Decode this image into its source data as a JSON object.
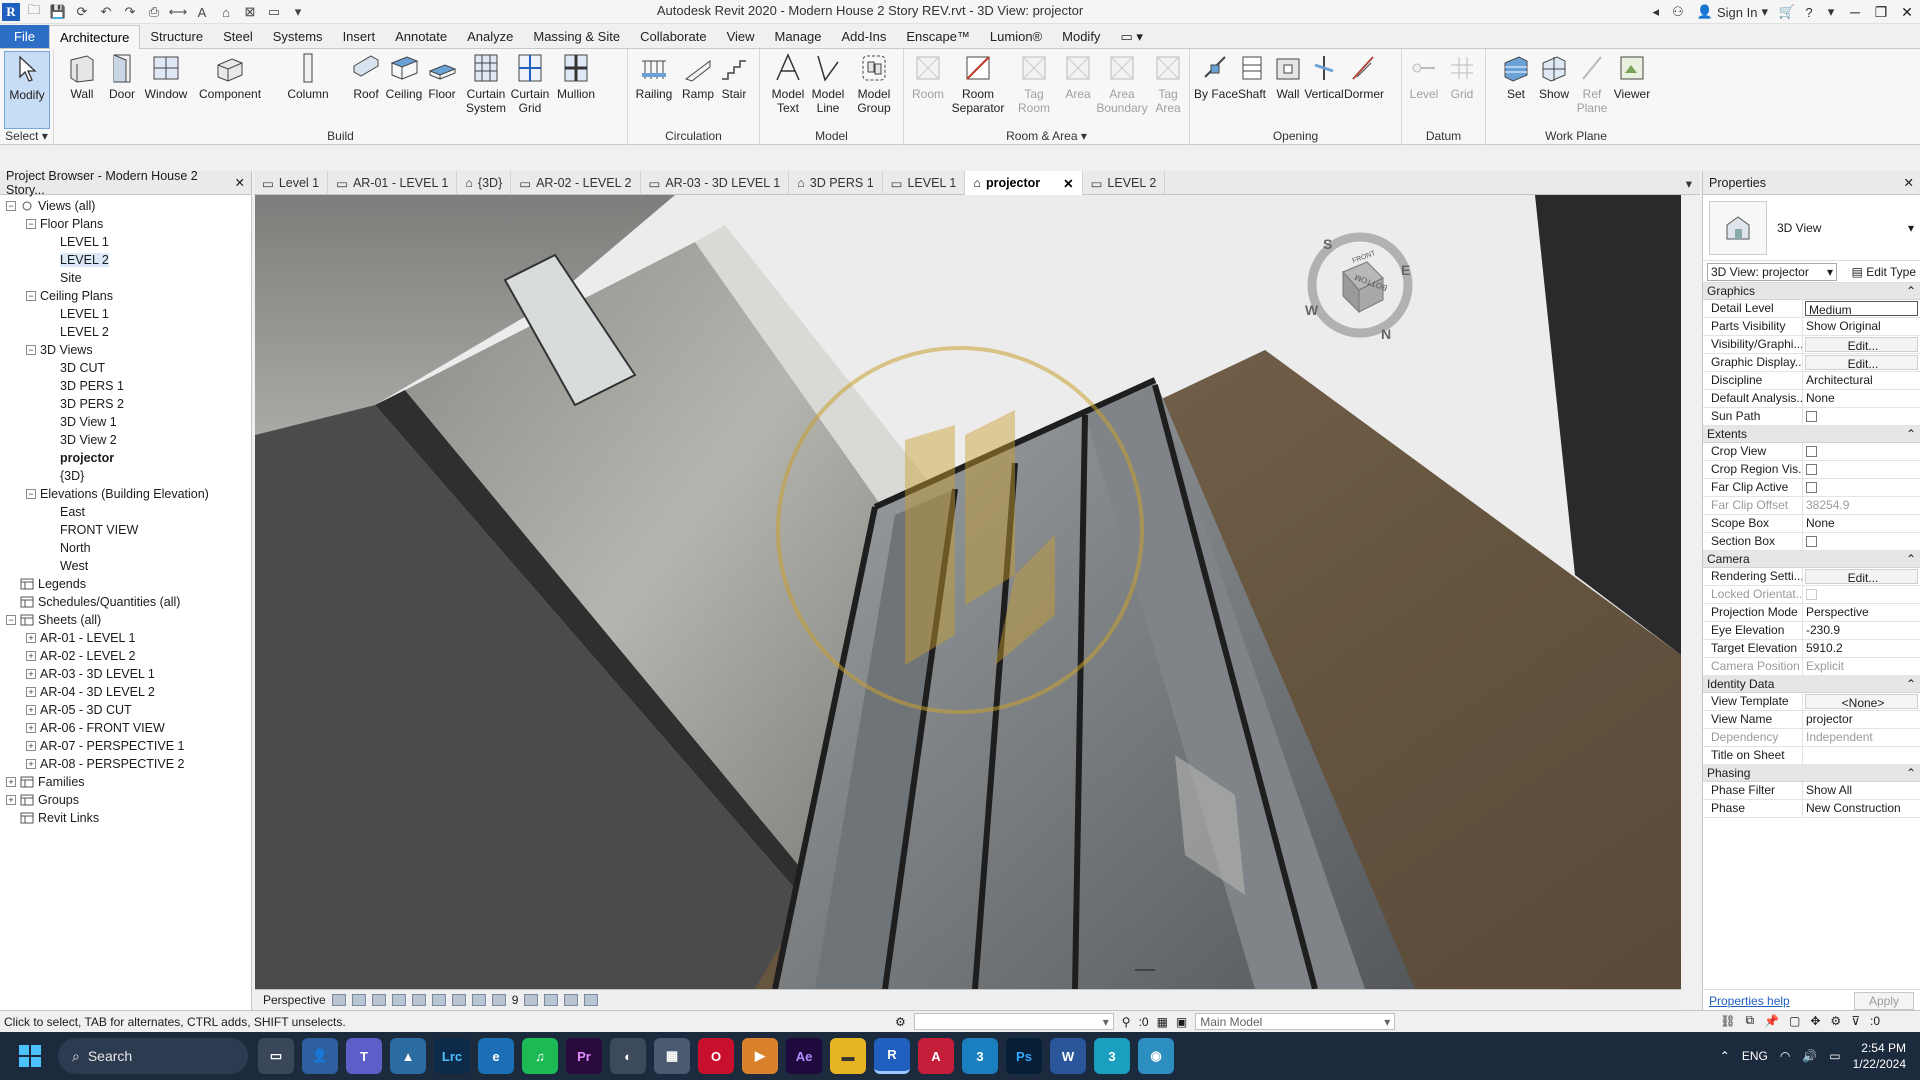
{
  "window": {
    "title": "Autodesk Revit 2020 - Modern House 2 Story REV.rvt - 3D View: projector",
    "sign_in": "Sign In"
  },
  "ribbon_tabs": [
    "File",
    "Architecture",
    "Structure",
    "Steel",
    "Systems",
    "Insert",
    "Annotate",
    "Analyze",
    "Massing & Site",
    "Collaborate",
    "View",
    "Manage",
    "Add-Ins",
    "Enscape™",
    "Lumion®",
    "Modify"
  ],
  "ribbon": {
    "select_label": "Select ▾",
    "groups": {
      "build": "Build",
      "circulation": "Circulation",
      "model": "Model",
      "room_area": "Room & Area ▾",
      "opening": "Opening",
      "datum": "Datum",
      "work_plane": "Work Plane"
    },
    "buttons": {
      "modify": "Modify",
      "wall": "Wall",
      "door": "Door",
      "window": "Window",
      "component": "Component",
      "column": "Column",
      "roof": "Roof",
      "ceiling": "Ceiling",
      "floor": "Floor",
      "curtain_system": "Curtain System",
      "curtain_grid": "Curtain Grid",
      "mullion": "Mullion",
      "railing": "Railing",
      "ramp": "Ramp",
      "stair": "Stair",
      "model_text": "Model Text",
      "model_line": "Model Line",
      "model_group": "Model Group",
      "room": "Room",
      "room_separator": "Room Separator",
      "tag_room": "Tag Room",
      "area": "Area",
      "area_boundary": "Area Boundary",
      "tag_area": "Tag Area",
      "by_face": "By Face",
      "shaft": "Shaft",
      "wall_opening": "Wall",
      "vertical": "Vertical",
      "dormer": "Dormer",
      "level": "Level",
      "grid": "Grid",
      "set": "Set",
      "show": "Show",
      "ref_plane": "Ref Plane",
      "viewer": "Viewer"
    }
  },
  "view_tabs": [
    {
      "label": "Level 1"
    },
    {
      "label": "AR-01 - LEVEL 1"
    },
    {
      "label": "{3D}"
    },
    {
      "label": "AR-02 - LEVEL 2"
    },
    {
      "label": "AR-03 - 3D LEVEL 1"
    },
    {
      "label": "3D PERS 1"
    },
    {
      "label": "LEVEL 1"
    },
    {
      "label": "projector"
    },
    {
      "label": "LEVEL 2"
    }
  ],
  "project_browser": {
    "title": "Project Browser - Modern House 2 Story...",
    "tree": [
      {
        "label": "Views (all)",
        "level": 0,
        "exp": "−"
      },
      {
        "label": "Floor Plans",
        "level": 1,
        "exp": "−"
      },
      {
        "label": "LEVEL 1",
        "level": 2
      },
      {
        "label": "LEVEL 2",
        "level": 2,
        "sel": true
      },
      {
        "label": "Site",
        "level": 2
      },
      {
        "label": "Ceiling Plans",
        "level": 1,
        "exp": "−"
      },
      {
        "label": "LEVEL 1",
        "level": 2
      },
      {
        "label": "LEVEL 2",
        "level": 2
      },
      {
        "label": "3D Views",
        "level": 1,
        "exp": "−"
      },
      {
        "label": "3D CUT",
        "level": 2
      },
      {
        "label": "3D PERS 1",
        "level": 2
      },
      {
        "label": "3D PERS 2",
        "level": 2
      },
      {
        "label": "3D View 1",
        "level": 2
      },
      {
        "label": "3D View 2",
        "level": 2
      },
      {
        "label": "projector",
        "level": 2,
        "bold": true
      },
      {
        "label": "{3D}",
        "level": 2
      },
      {
        "label": "Elevations (Building Elevation)",
        "level": 1,
        "exp": "−"
      },
      {
        "label": "East",
        "level": 2
      },
      {
        "label": "FRONT VIEW",
        "level": 2
      },
      {
        "label": "North",
        "level": 2
      },
      {
        "label": "West",
        "level": 2
      },
      {
        "label": "Legends",
        "level": 0,
        "icon": true
      },
      {
        "label": "Schedules/Quantities (all)",
        "level": 0,
        "icon": true
      },
      {
        "label": "Sheets (all)",
        "level": 0,
        "exp": "−",
        "icon": true
      },
      {
        "label": "AR-01 - LEVEL 1",
        "level": 1,
        "exp": "+"
      },
      {
        "label": "AR-02 - LEVEL 2",
        "level": 1,
        "exp": "+"
      },
      {
        "label": "AR-03 - 3D LEVEL 1",
        "level": 1,
        "exp": "+"
      },
      {
        "label": "AR-04 - 3D LEVEL 2",
        "level": 1,
        "exp": "+"
      },
      {
        "label": "AR-05 - 3D CUT",
        "level": 1,
        "exp": "+"
      },
      {
        "label": "AR-06 - FRONT VIEW",
        "level": 1,
        "exp": "+"
      },
      {
        "label": "AR-07 - PERSPECTIVE 1",
        "level": 1,
        "exp": "+"
      },
      {
        "label": "AR-08 - PERSPECTIVE 2",
        "level": 1,
        "exp": "+"
      },
      {
        "label": "Families",
        "level": 0,
        "exp": "+",
        "icon": true
      },
      {
        "label": "Groups",
        "level": 0,
        "exp": "+",
        "icon": true
      },
      {
        "label": "Revit Links",
        "level": 0,
        "icon": true
      }
    ]
  },
  "view_bar": {
    "mode": "Perspective",
    "scale": "9"
  },
  "viewcube": {
    "front": "FRONT",
    "bottom": "BOTTOM",
    "compass": {
      "n": "N",
      "s": "S",
      "e": "E",
      "w": "W"
    }
  },
  "properties": {
    "title": "Properties",
    "type_name": "3D View",
    "instance_selector": "3D View: projector",
    "edit_type": "Edit Type",
    "categories": [
      {
        "name": "Graphics",
        "rows": [
          {
            "k": "Detail Level",
            "v": "Medium",
            "style": "boxed"
          },
          {
            "k": "Parts Visibility",
            "v": "Show Original"
          },
          {
            "k": "Visibility/Graphi...",
            "v": "Edit...",
            "style": "btn"
          },
          {
            "k": "Graphic Display...",
            "v": "Edit...",
            "style": "btn"
          },
          {
            "k": "Discipline",
            "v": "Architectural"
          },
          {
            "k": "Default Analysis...",
            "v": "None"
          },
          {
            "k": "Sun Path",
            "v": "",
            "style": "cb"
          }
        ]
      },
      {
        "name": "Extents",
        "rows": [
          {
            "k": "Crop View",
            "v": "",
            "style": "cb"
          },
          {
            "k": "Crop Region Vis...",
            "v": "",
            "style": "cb"
          },
          {
            "k": "Far Clip Active",
            "v": "",
            "style": "cb"
          },
          {
            "k": "Far Clip Offset",
            "v": "38254.9",
            "style": "dis"
          },
          {
            "k": "Scope Box",
            "v": "None"
          },
          {
            "k": "Section Box",
            "v": "",
            "style": "cb"
          }
        ]
      },
      {
        "name": "Camera",
        "rows": [
          {
            "k": "Rendering Setti...",
            "v": "Edit...",
            "style": "btn"
          },
          {
            "k": "Locked Orientat...",
            "v": "",
            "style": "cbdis"
          },
          {
            "k": "Projection Mode",
            "v": "Perspective"
          },
          {
            "k": "Eye Elevation",
            "v": "-230.9"
          },
          {
            "k": "Target Elevation",
            "v": "5910.2"
          },
          {
            "k": "Camera Position",
            "v": "Explicit",
            "style": "dis"
          }
        ]
      },
      {
        "name": "Identity Data",
        "rows": [
          {
            "k": "View Template",
            "v": "<None>",
            "style": "btn"
          },
          {
            "k": "View Name",
            "v": "projector"
          },
          {
            "k": "Dependency",
            "v": "Independent",
            "style": "dis"
          },
          {
            "k": "Title on Sheet",
            "v": ""
          }
        ]
      },
      {
        "name": "Phasing",
        "rows": [
          {
            "k": "Phase Filter",
            "v": "Show All"
          },
          {
            "k": "Phase",
            "v": "New Construction"
          }
        ]
      }
    ],
    "help": "Properties help",
    "apply": "Apply"
  },
  "status": {
    "hint": "Click to select, TAB for alternates, CTRL adds, SHIFT unselects.",
    "count": ":0",
    "model": "Main Model",
    "filter_count": ":0"
  },
  "taskbar": {
    "search": "Search",
    "lang": "ENG",
    "time": "2:54 PM",
    "date": "1/22/2024",
    "apps": [
      "Lrc",
      "Pr",
      "Ae",
      "R",
      "Ps",
      "W"
    ]
  },
  "colors": {
    "accent": "#2d6fc7",
    "taskbar": "#1c2a3d",
    "wood": "#6b5a48",
    "concrete": "#9a9a96"
  }
}
